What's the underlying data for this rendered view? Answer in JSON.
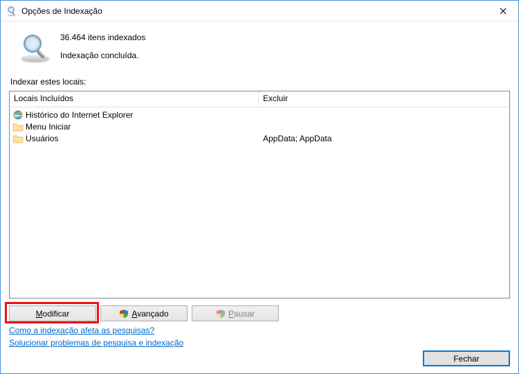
{
  "window": {
    "title": "Opções de Indexação"
  },
  "status": {
    "count_line": "36.464 itens indexados",
    "state_line": "Indexação concluída."
  },
  "locations": {
    "label": "Indexar estes locais:",
    "col_included": "Locais Incluídos",
    "col_exclude": "Excluir",
    "rows": [
      {
        "name": "Histórico do Internet Explorer",
        "exclude": ""
      },
      {
        "name": "Menu Iniciar",
        "exclude": ""
      },
      {
        "name": "Usuários",
        "exclude": "AppData; AppData"
      }
    ]
  },
  "buttons": {
    "modify": {
      "prefix": "M",
      "rest": "odificar"
    },
    "advanced": {
      "prefix": "A",
      "rest": "vançado"
    },
    "pause": {
      "prefix": "P",
      "rest": "ausar"
    },
    "close": "Fechar"
  },
  "links": {
    "howaffects": "Como a indexação afeta as pesquisas?",
    "troubleshoot": "Solucionar problemas de pesquisa e indexação"
  }
}
